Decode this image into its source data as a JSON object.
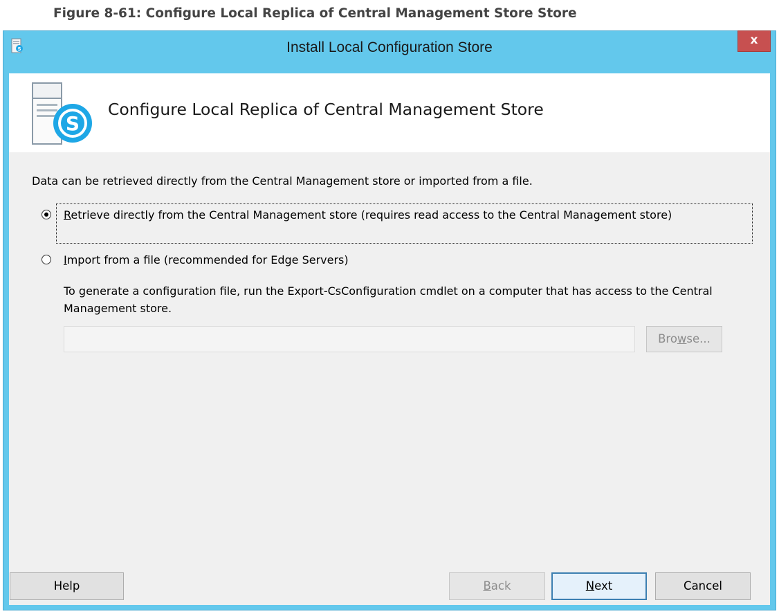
{
  "figure_caption": "Figure 8-61:   Configure Local Replica of Central Management Store Store",
  "window": {
    "title": "Install Local Configuration Store",
    "close_label": "x"
  },
  "header": {
    "title": "Configure Local Replica of Central Management Store"
  },
  "description": "Data can be retrieved directly from the Central Management store or imported from a file.",
  "options": [
    {
      "mnemonic": "R",
      "label": "etrieve directly from the Central Management store (requires read access to the Central Management store)",
      "selected": true
    },
    {
      "mnemonic": "I",
      "label": "mport from a file (recommended for Edge Servers)",
      "selected": false
    }
  ],
  "import_hint": "To generate a configuration file, run the Export-CsConfiguration cmdlet on a computer that has access to the Central Management store.",
  "file_path": {
    "value": "",
    "enabled": false
  },
  "buttons": {
    "browse": {
      "pre": "Bro",
      "mnemonic": "w",
      "post": "se...",
      "enabled": false
    },
    "help": {
      "label": "Help",
      "enabled": true
    },
    "back": {
      "mnemonic": "B",
      "post": "ack",
      "enabled": false
    },
    "next": {
      "mnemonic": "N",
      "post": "ext",
      "enabled": true
    },
    "cancel": {
      "label": "Cancel",
      "enabled": true
    }
  },
  "colors": {
    "title_bar": "#63c8ec",
    "close_button": "#c75050",
    "skype_blue": "#1ea7e6",
    "dialog_background": "#f0f0f0"
  },
  "icons": {
    "app": "skype-server-icon",
    "header": "skype-server-tower-icon"
  }
}
